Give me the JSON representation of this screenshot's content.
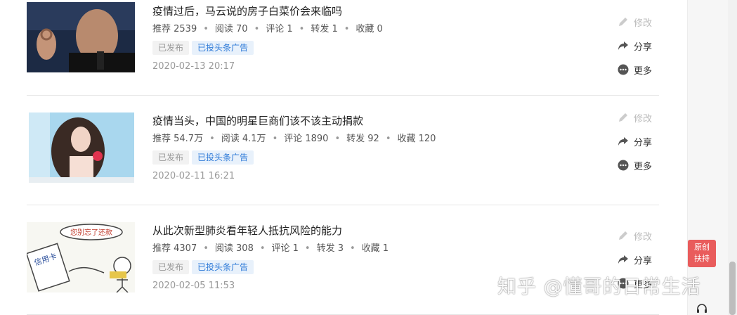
{
  "articles": [
    {
      "title": "疫情过后，马云说的房子白菜价会来临吗",
      "stats": [
        "推荐 2539",
        "阅读 70",
        "评论 1",
        "转发 1",
        "收藏 0"
      ],
      "tags": [
        "已发布",
        "已投头条广告"
      ],
      "date": "2020-02-13 20:17"
    },
    {
      "title": "疫情当头，中国的明星巨商们该不该主动捐款",
      "stats": [
        "推荐 54.7万",
        "阅读 4.1万",
        "评论 1890",
        "转发 92",
        "收藏 120"
      ],
      "tags": [
        "已发布",
        "已投头条广告"
      ],
      "date": "2020-02-11 16:21"
    },
    {
      "title": "从此次新型肺炎看年轻人抵抗风险的能力",
      "stats": [
        "推荐 4307",
        "阅读 308",
        "评论 1",
        "转发 3",
        "收藏 1"
      ],
      "tags": [
        "已发布",
        "已投头条广告"
      ],
      "date": "2020-02-05 11:53"
    }
  ],
  "actions": {
    "edit": "修改",
    "share": "分享",
    "more": "更多"
  },
  "thumbnail3_text": {
    "bubble": "您别忘了还款",
    "card": "信用卡"
  },
  "badge": {
    "line1": "原创",
    "line2": "扶持"
  },
  "watermark": "知乎 @懂哥的日常生活",
  "colors": {
    "accent_blue": "#2e7ad8",
    "badge_red": "#e95c5c",
    "tag_gray_bg": "#f2f2f2",
    "tag_blue_bg": "#e8f1fb"
  },
  "icons": {
    "edit": "pencil-icon",
    "share": "share-arrow-icon",
    "more": "more-dots-icon",
    "support": "headset-icon"
  }
}
